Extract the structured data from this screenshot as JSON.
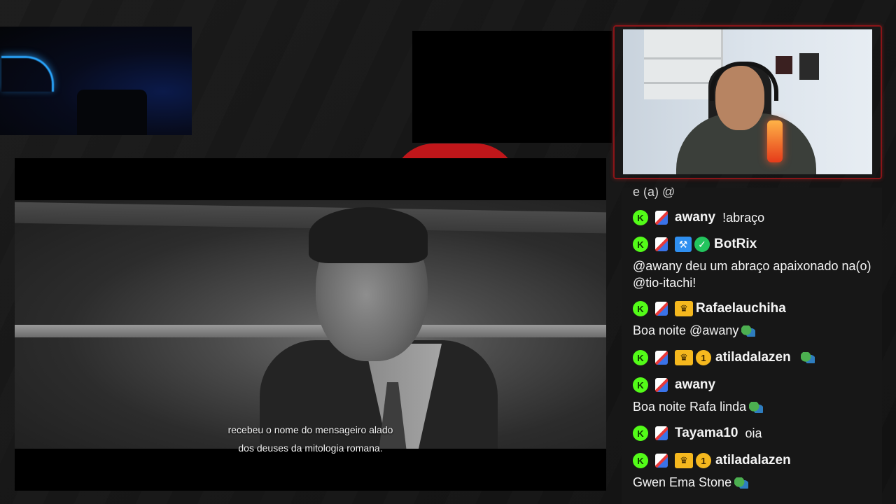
{
  "video": {
    "subtitle_line1": "recebeu o nome do mensageiro alado",
    "subtitle_line2": "dos deuses da mitologia romana."
  },
  "chat": {
    "cut_off_text": "e (a) @",
    "messages": [
      {
        "username": "awany",
        "inline": "!abraço",
        "badges": [
          "kick-badge",
          "app-badge"
        ]
      },
      {
        "username": "BotRix",
        "text": "@awany deu um abraço apaixonado na(o) @tio-itachi!",
        "badges": [
          "kick-badge",
          "app-badge",
          "moderator-badge",
          "verified-badge"
        ]
      },
      {
        "username": "Rafaelauchiha",
        "text": "Boa noite @awany",
        "badges": [
          "kick-badge",
          "app-badge",
          "crown-badge"
        ]
      },
      {
        "username": "atiladalazen",
        "inline": "",
        "badges": [
          "kick-badge",
          "app-badge",
          "crown-badge",
          "sub-1-badge"
        ],
        "sub_months": "1"
      },
      {
        "username": "awany",
        "text": "Boa noite Rafa linda",
        "badges": [
          "kick-badge",
          "app-badge"
        ]
      },
      {
        "username": "Tayama10",
        "inline": "oia",
        "badges": [
          "kick-badge",
          "app-badge"
        ]
      },
      {
        "username": "atiladalazen",
        "text": "Gwen Ema Stone",
        "badges": [
          "kick-badge",
          "app-badge",
          "crown-badge",
          "sub-1-badge"
        ],
        "sub_months": "1"
      }
    ]
  },
  "colors": {
    "kick_green": "#53fc18",
    "frame_red": "#8a1518",
    "crown_gold": "#f5b81e"
  }
}
